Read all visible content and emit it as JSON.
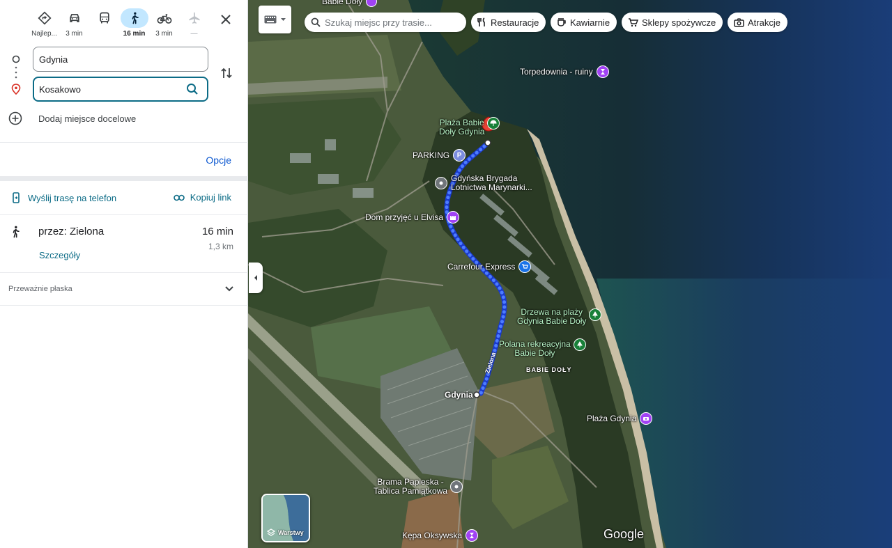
{
  "modes": [
    {
      "name": "best",
      "label": "Najlep...",
      "icon": "directions-diamond-icon",
      "active": false
    },
    {
      "name": "car",
      "label": "3 min",
      "icon": "car-icon",
      "active": false
    },
    {
      "name": "transit",
      "label": "",
      "icon": "bus-icon",
      "active": false
    },
    {
      "name": "walk",
      "label": "16 min",
      "icon": "walk-icon",
      "active": true
    },
    {
      "name": "bike",
      "label": "3 min",
      "icon": "bike-icon",
      "active": false
    },
    {
      "name": "flight",
      "label": "—",
      "icon": "plane-icon",
      "active": false
    }
  ],
  "origin": {
    "value": "Gdynia"
  },
  "destination": {
    "value": "Kosakowo"
  },
  "add_destination": "Dodaj miejsce docelowe",
  "options_label": "Opcje",
  "send_to_phone": "Wyślij trasę na telefon",
  "copy_link": "Kopiuj link",
  "route": {
    "via": "przez: Zielona",
    "duration": "16 min",
    "distance": "1,3 km",
    "details": "Szczegóły",
    "terrain": "Przeważnie płaska"
  },
  "map": {
    "search_placeholder": "Szukaj miejsc przy trasie...",
    "chips": [
      "Restauracje",
      "Kawiarnie",
      "Sklepy spożywcze",
      "Atrakcje"
    ],
    "layers_label": "Warstwy",
    "google_logo": "Google",
    "village_label": "BABIE DOŁY",
    "street_label": "Zielona",
    "origin_marker_label": "Gdynia",
    "pois": {
      "top": "Babie Doły",
      "torpedownia": "Torpedownia - ruiny",
      "plaza_babie_1": "Plaża Babie",
      "plaza_babie_2": "Doły Gdynia",
      "parking": "PARKING",
      "brygada_1": "Gdyńska Brygada",
      "brygada_2": "Lotnictwa Marynarki...",
      "dom": "Dom przyjęć u Elvisa",
      "carrefour": "Carrefour Express",
      "drzewa_1": "Drzewa na plaży",
      "drzewa_2": "Gdynia Babie Doły",
      "polana_1": "Polana rekreacyjna",
      "polana_2": "Babie Doły",
      "plaza_gdynia": "Plaża Gdynia",
      "brama_1": "Brama Papieska -",
      "brama_2": "Tablica Pamiątkowa",
      "kepa": "Kępa Oksywska"
    }
  },
  "colors": {
    "accent": "#0b6b86",
    "active_mode": "#c2e7ff",
    "route": "#1a4cff",
    "poi_purple": "#a142f4",
    "poi_green": "#188038"
  }
}
